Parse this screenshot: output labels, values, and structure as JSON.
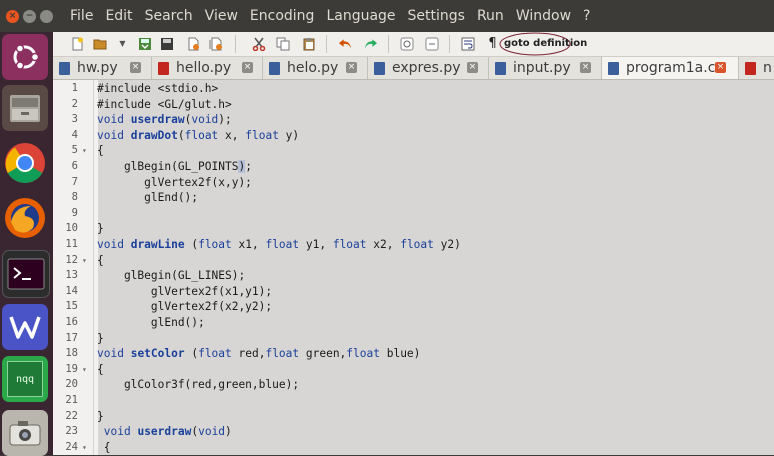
{
  "menubar": {
    "items": [
      "File",
      "Edit",
      "Search",
      "View",
      "Encoding",
      "Language",
      "Settings",
      "Run",
      "Window",
      "?"
    ]
  },
  "launcher": {
    "apps": [
      "ubuntu-logo-icon",
      "files-icon",
      "chrome-icon",
      "firefox-icon",
      "terminal-icon",
      "wps-writer-icon",
      "nqq-icon",
      "screenshot-icon"
    ],
    "nqq_label": "nqq"
  },
  "toolbar": {
    "pilcrow": "¶",
    "annotation_label": "goto definition"
  },
  "tabs": [
    {
      "label": "hw.py",
      "active": false,
      "modified": false
    },
    {
      "label": "hello.py",
      "active": false,
      "modified": true
    },
    {
      "label": "helo.py",
      "active": false,
      "modified": false
    },
    {
      "label": "expres.py",
      "active": false,
      "modified": false
    },
    {
      "label": "input.py",
      "active": false,
      "modified": false
    },
    {
      "label": "program1a.c",
      "active": true,
      "modified": false
    },
    {
      "label": "n",
      "active": false,
      "modified": true
    }
  ],
  "editor": {
    "lines": [
      {
        "n": "1",
        "fold": "",
        "tokens": [
          [
            "#include <stdio.h>",
            ""
          ]
        ]
      },
      {
        "n": "2",
        "fold": "",
        "tokens": [
          [
            "#include <GL/glut.h>",
            ""
          ]
        ]
      },
      {
        "n": "3",
        "fold": "",
        "tokens": [
          [
            "void",
            "kw"
          ],
          [
            " ",
            ""
          ],
          [
            "userdraw",
            "fn"
          ],
          [
            "(",
            ""
          ],
          [
            "void",
            "kw"
          ],
          [
            ");",
            ""
          ]
        ]
      },
      {
        "n": "4",
        "fold": "",
        "tokens": [
          [
            "void",
            "kw"
          ],
          [
            " ",
            ""
          ],
          [
            "drawDot",
            "fn"
          ],
          [
            "(",
            ""
          ],
          [
            "float",
            "kw"
          ],
          [
            " x, ",
            ""
          ],
          [
            "float",
            "kw"
          ],
          [
            " y)",
            ""
          ]
        ]
      },
      {
        "n": "5",
        "fold": "▾",
        "tokens": [
          [
            "{",
            ""
          ]
        ]
      },
      {
        "n": "6",
        "fold": "",
        "tokens": [
          [
            "    glBegin(GL_POINTS",
            ""
          ],
          [
            ")",
            "hl"
          ],
          [
            ";",
            ""
          ]
        ]
      },
      {
        "n": "7",
        "fold": "",
        "tokens": [
          [
            "       glVertex2f(x,y);",
            ""
          ]
        ]
      },
      {
        "n": "8",
        "fold": "",
        "tokens": [
          [
            "       glEnd();",
            ""
          ]
        ]
      },
      {
        "n": "9",
        "fold": "",
        "tokens": [
          [
            "",
            ""
          ]
        ]
      },
      {
        "n": "10",
        "fold": "",
        "tokens": [
          [
            "}",
            ""
          ]
        ]
      },
      {
        "n": "11",
        "fold": "",
        "tokens": [
          [
            "void",
            "kw"
          ],
          [
            " ",
            ""
          ],
          [
            "drawLine",
            "fn"
          ],
          [
            " (",
            ""
          ],
          [
            "float",
            "kw"
          ],
          [
            " x1, ",
            ""
          ],
          [
            "float",
            "kw"
          ],
          [
            " y1, ",
            ""
          ],
          [
            "float",
            "kw"
          ],
          [
            " x2, ",
            ""
          ],
          [
            "float",
            "kw"
          ],
          [
            " y2)",
            ""
          ]
        ]
      },
      {
        "n": "12",
        "fold": "▾",
        "tokens": [
          [
            "{",
            ""
          ]
        ]
      },
      {
        "n": "13",
        "fold": "",
        "tokens": [
          [
            "    glBegin(GL_LINES);",
            ""
          ]
        ]
      },
      {
        "n": "14",
        "fold": "",
        "tokens": [
          [
            "        glVertex2f(x1,y1);",
            ""
          ]
        ]
      },
      {
        "n": "15",
        "fold": "",
        "tokens": [
          [
            "        glVertex2f(x2,y2);",
            ""
          ]
        ]
      },
      {
        "n": "16",
        "fold": "",
        "tokens": [
          [
            "        glEnd();",
            ""
          ]
        ]
      },
      {
        "n": "17",
        "fold": "",
        "tokens": [
          [
            "}",
            ""
          ]
        ]
      },
      {
        "n": "18",
        "fold": "",
        "tokens": [
          [
            "void",
            "kw"
          ],
          [
            " ",
            ""
          ],
          [
            "setColor",
            "fn"
          ],
          [
            " (",
            ""
          ],
          [
            "float",
            "kw"
          ],
          [
            " red,",
            ""
          ],
          [
            "float",
            "kw"
          ],
          [
            " green,",
            ""
          ],
          [
            "float",
            "kw"
          ],
          [
            " blue)",
            ""
          ]
        ]
      },
      {
        "n": "19",
        "fold": "▾",
        "tokens": [
          [
            "{",
            ""
          ]
        ]
      },
      {
        "n": "20",
        "fold": "",
        "tokens": [
          [
            "    glColor3f(red,green,blue);",
            ""
          ]
        ]
      },
      {
        "n": "21",
        "fold": "",
        "tokens": [
          [
            "",
            ""
          ]
        ]
      },
      {
        "n": "22",
        "fold": "",
        "tokens": [
          [
            "}",
            ""
          ]
        ]
      },
      {
        "n": "23",
        "fold": "",
        "tokens": [
          [
            " ",
            ""
          ],
          [
            "void",
            "kw"
          ],
          [
            " ",
            ""
          ],
          [
            "userdraw",
            "fn"
          ],
          [
            "(",
            ""
          ],
          [
            "void",
            "kw"
          ],
          [
            ")",
            ""
          ]
        ]
      },
      {
        "n": "24",
        "fold": "▾",
        "tokens": [
          [
            " {",
            ""
          ]
        ]
      }
    ]
  },
  "colors": {
    "menubar_bg": "#3c3b37",
    "launcher_bg": "#3a2630",
    "code_bg": "#d7d6d4",
    "keyword": "#1b3f9a",
    "close_accent": "#d9542a",
    "annotation_circle": "#7a2030"
  }
}
